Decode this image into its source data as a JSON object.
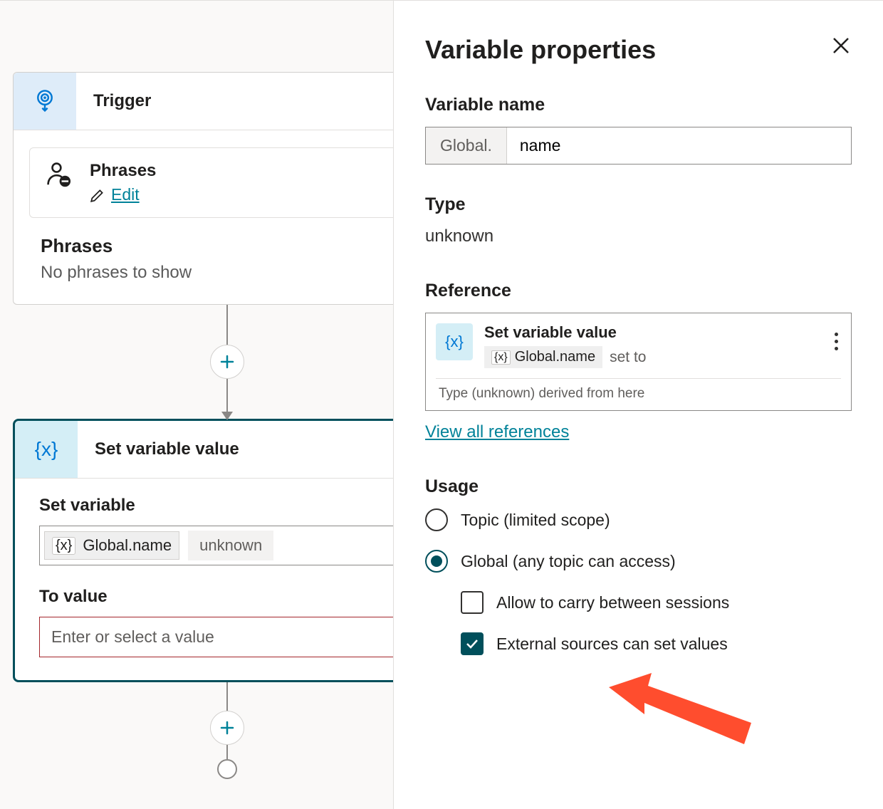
{
  "canvas": {
    "trigger": {
      "title": "Trigger",
      "phrases_label": "Phrases",
      "edit_label": "Edit",
      "empty_heading": "Phrases",
      "empty_sub": "No phrases to show"
    },
    "setvar": {
      "title": "Set variable value",
      "field1_label": "Set variable",
      "var_name": "Global.name",
      "var_type": "unknown",
      "field2_label": "To value",
      "value_placeholder": "Enter or select a value"
    }
  },
  "panel": {
    "title": "Variable properties",
    "name_label": "Variable name",
    "name_prefix": "Global.",
    "name_value": "name",
    "type_label": "Type",
    "type_value": "unknown",
    "reference_label": "Reference",
    "reference": {
      "title": "Set variable value",
      "var": "Global.name",
      "suffix": "set to",
      "derived": "Type (unknown) derived from here"
    },
    "view_all": "View all references",
    "usage_label": "Usage",
    "usage_options": {
      "topic": "Topic (limited scope)",
      "global": "Global (any topic can access)",
      "allow_carry": "Allow to carry between sessions",
      "external": "External sources can set values"
    }
  }
}
